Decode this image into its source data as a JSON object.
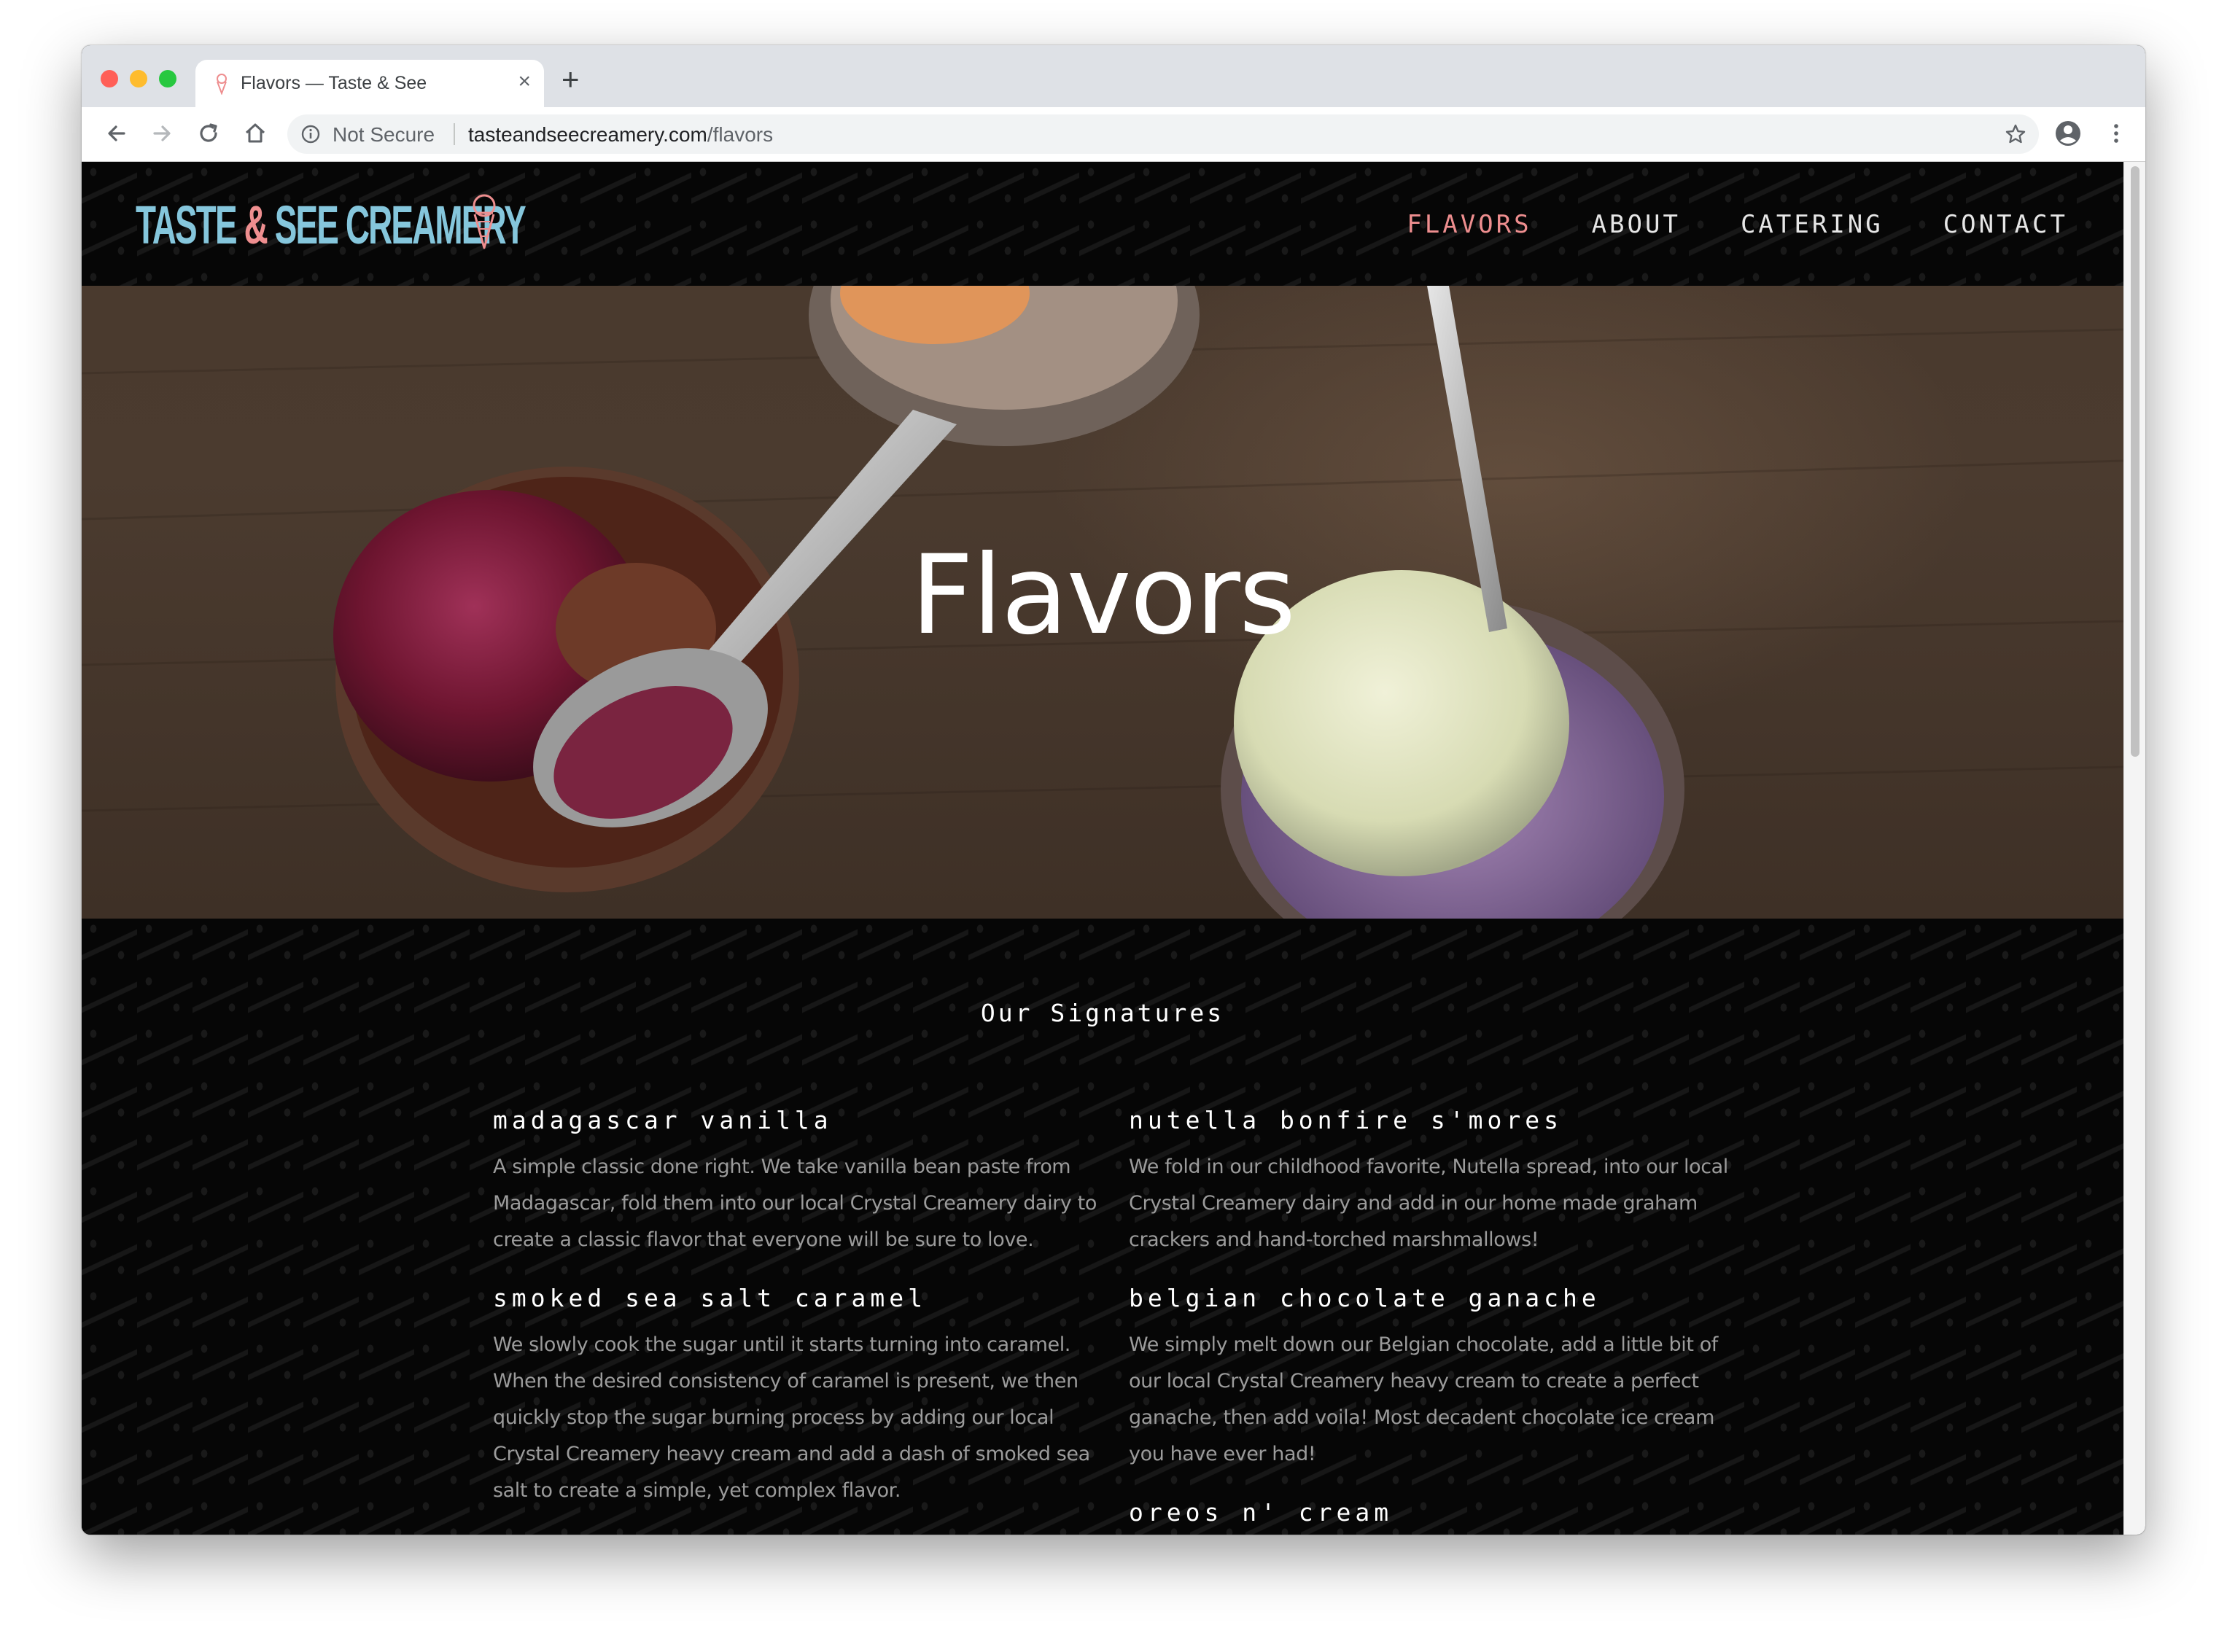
{
  "browser": {
    "tab_title": "Flavors — Taste & See",
    "tab_close": "×",
    "new_tab": "+",
    "security_label": "Not Secure",
    "url_domain": "tasteandseecreamery.com",
    "url_path": "/flavors"
  },
  "site": {
    "logo": {
      "part1": "TASTE",
      "amp": "&",
      "part2": "SEE CREAMERY"
    },
    "nav": [
      {
        "label": "FLAVORS",
        "active": true
      },
      {
        "label": "ABOUT",
        "active": false
      },
      {
        "label": "CATERING",
        "active": false
      },
      {
        "label": "CONTACT",
        "active": false
      }
    ],
    "hero_title": "Flavors",
    "section_title": "Our Signatures",
    "flavors": [
      {
        "name": "madagascar vanilla",
        "description": "A simple classic done right. We take vanilla bean paste from Madagascar, fold them into our local Crystal Creamery dairy to create a classic flavor that everyone will be sure to love."
      },
      {
        "name": "nutella bonfire s'mores",
        "description": "We fold in our childhood favorite, Nutella spread, into our local Crystal Creamery dairy and add in our home made graham crackers and hand-torched marshmallows!"
      },
      {
        "name": "smoked sea salt caramel",
        "description": "We slowly cook the sugar until it starts turning into caramel. When the desired consistency of caramel is present, we then quickly stop the sugar burning process by adding our local Crystal Creamery heavy cream and add a dash of smoked sea salt to create a simple, yet complex flavor."
      },
      {
        "name": "belgian chocolate ganache",
        "description": "We simply melt down our Belgian chocolate, add a little bit of our local Crystal Creamery heavy cream to create a perfect ganache, then add voila! Most decadent chocolate ice cream you have ever had!"
      },
      {
        "name": "oreos n' cream",
        "description": ""
      }
    ]
  },
  "colors": {
    "accent_pink": "#ee8e8f",
    "logo_blue": "#85c6dc",
    "background": "#060606"
  },
  "icons": [
    "back-arrow-icon",
    "forward-arrow-icon",
    "reload-icon",
    "home-icon",
    "info-icon",
    "star-icon",
    "account-icon",
    "menu-dots-icon",
    "ice-cream-cone-icon"
  ]
}
